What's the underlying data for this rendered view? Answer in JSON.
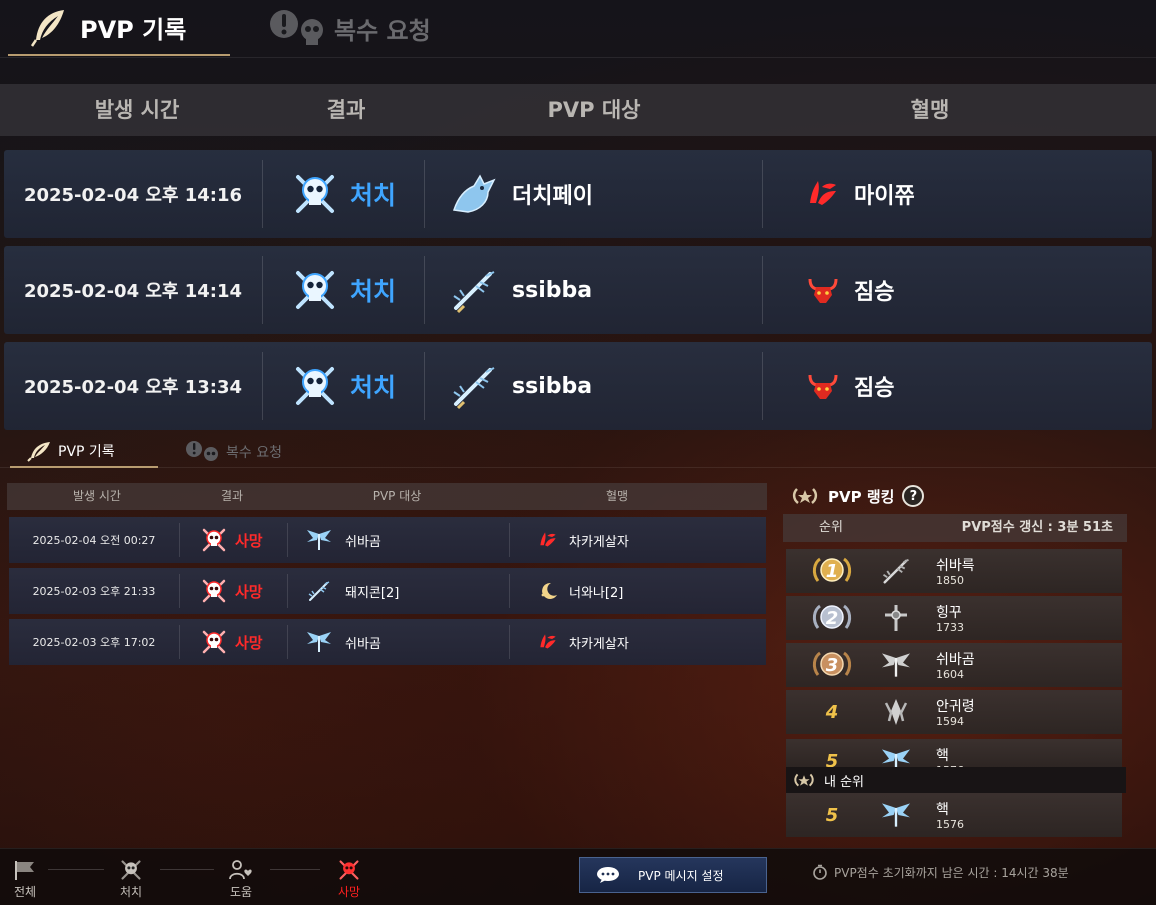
{
  "big": {
    "tabs": {
      "active": "PVP 기록",
      "inactive": "복수 요청"
    },
    "headers": {
      "time": "발생 시간",
      "result": "결과",
      "target": "PVP 대상",
      "guild": "혈맹"
    },
    "rows": [
      {
        "time": "2025-02-04 오후 14:16",
        "result": "처치",
        "target": "더치페이",
        "guild": "마이쮸"
      },
      {
        "time": "2025-02-04 오후 14:14",
        "result": "처치",
        "target": "ssibba",
        "guild": "짐승"
      },
      {
        "time": "2025-02-04 오후 13:34",
        "result": "처치",
        "target": "ssibba",
        "guild": "짐승"
      }
    ]
  },
  "small": {
    "tabs": {
      "active": "PVP 기록",
      "inactive": "복수 요청"
    },
    "headers": {
      "time": "발생 시간",
      "result": "결과",
      "target": "PVP 대상",
      "guild": "혈맹"
    },
    "rows": [
      {
        "time": "2025-02-04 오전 00:27",
        "result": "사망",
        "target": "쉬바곰",
        "guild": "차카게살자"
      },
      {
        "time": "2025-02-03 오후 21:33",
        "result": "사망",
        "target": "돼지콘[2]",
        "guild": "너와나[2]"
      },
      {
        "time": "2025-02-03 오후 17:02",
        "result": "사망",
        "target": "쉬바곰",
        "guild": "차카게살자"
      }
    ]
  },
  "ranking": {
    "title": "PVP 랭킹",
    "help": "?",
    "col_rank": "순위",
    "update": "PVP점수 갱신 : 3분 51초",
    "rows": [
      {
        "rank": "1",
        "name": "쉬바륵",
        "score": "1850"
      },
      {
        "rank": "2",
        "name": "힝꾸",
        "score": "1733"
      },
      {
        "rank": "3",
        "name": "쉬바곰",
        "score": "1604"
      },
      {
        "rank": "4",
        "name": "안귀령",
        "score": "1594"
      },
      {
        "rank": "5",
        "name": "핵",
        "score": "1576"
      }
    ],
    "my_title": "내 순위",
    "my": {
      "rank": "5",
      "name": "핵",
      "score": "1576"
    }
  },
  "bottom": {
    "filters": [
      "전체",
      "처치",
      "도움",
      "사망"
    ],
    "active_filter": "사망",
    "message_button": "PVP 메시지 설정",
    "reset_text": "PVP점수 초기화까지 남은 시간 : 14시간 38분"
  },
  "colors": {
    "kill": "#3fa5ff",
    "death": "#ff2a2a",
    "gold": "#f0c24a",
    "button": "#1f2f52"
  }
}
